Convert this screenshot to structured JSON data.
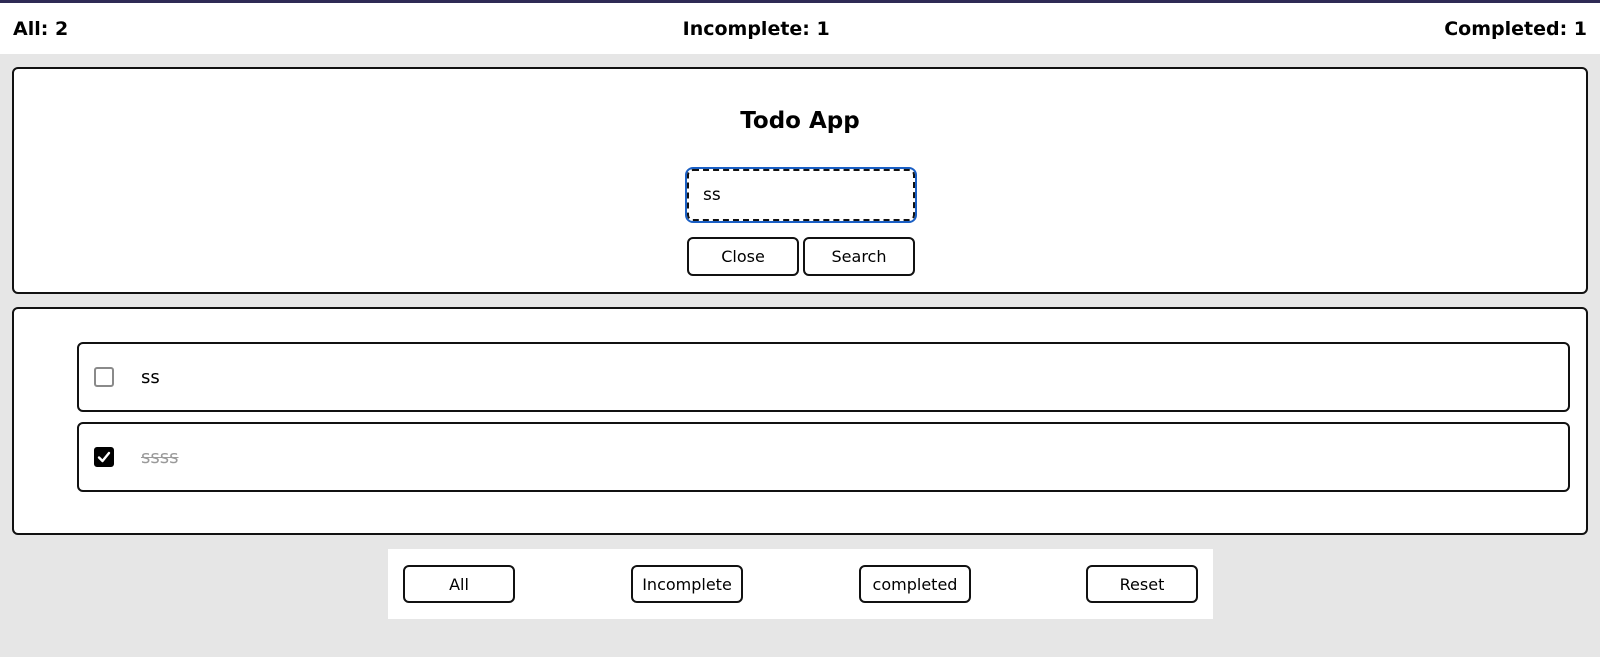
{
  "stats": {
    "all": "All: 2",
    "incomplete": "Incomplete: 1",
    "completed": "Completed: 1"
  },
  "header": {
    "title": "Todo App",
    "search_value": "ss",
    "close_label": "Close",
    "search_label": "Search"
  },
  "todos": [
    {
      "text": "ss",
      "completed": false
    },
    {
      "text": "ssss",
      "completed": true
    }
  ],
  "filters": {
    "all_label": "All",
    "incomplete_label": "Incomplete",
    "completed_label": "completed",
    "reset_label": "Reset"
  },
  "colors": {
    "accent_top": "#2e2a55",
    "focus_outline": "#1a5fc4",
    "background": "#e6e6e6"
  },
  "icons": {
    "checkbox_checked": "check-icon"
  }
}
